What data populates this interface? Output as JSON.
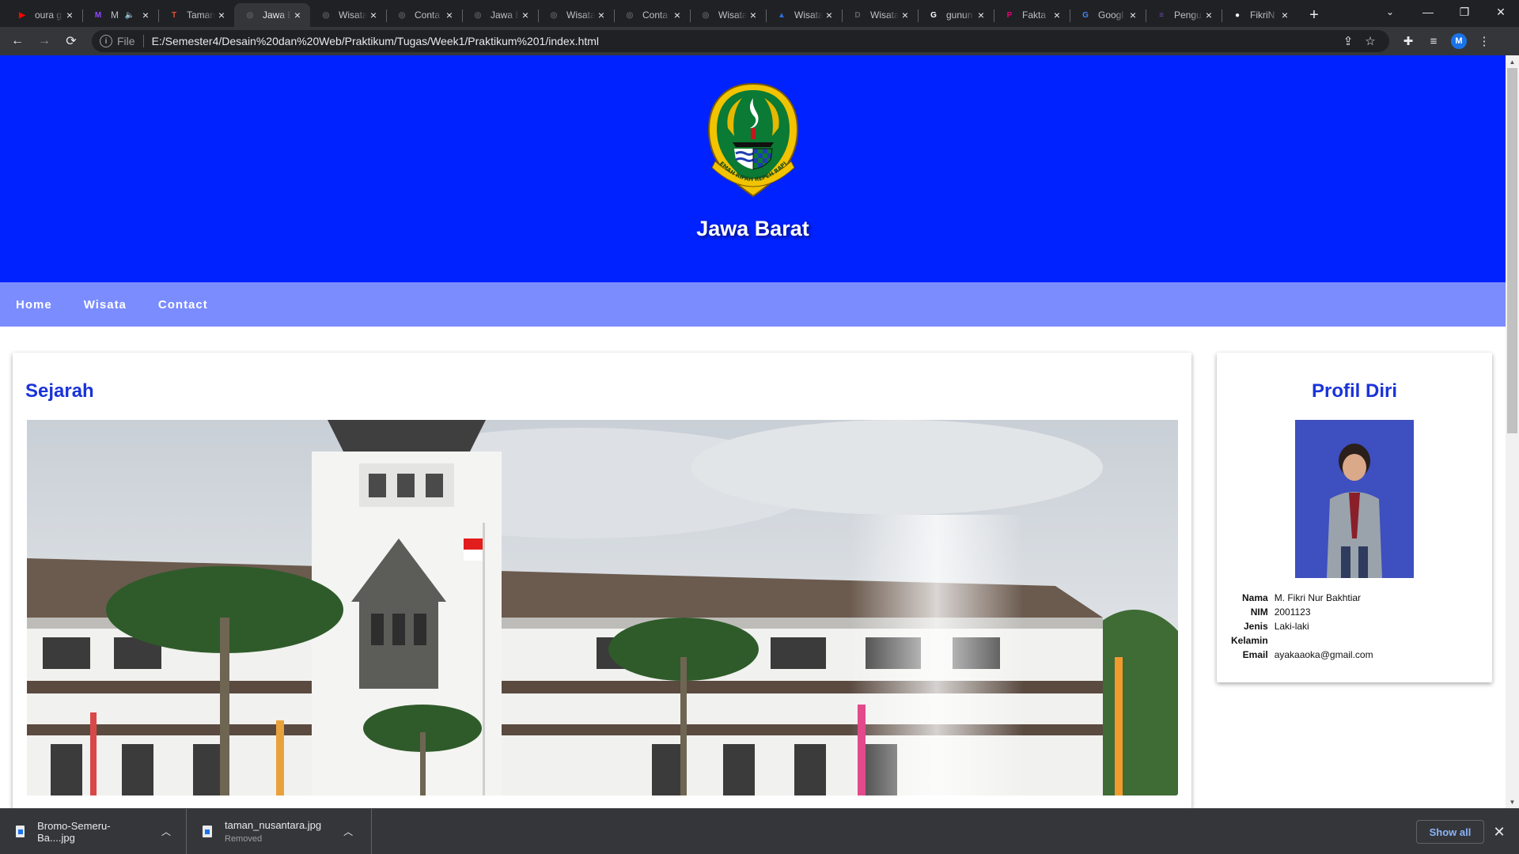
{
  "browser": {
    "tabs": [
      {
        "title": "oura g",
        "favicon": "youtube-icon",
        "color": "#ff0000",
        "glyph": "▶"
      },
      {
        "title": "M",
        "favicon": "twitch-icon",
        "color": "#9146ff",
        "glyph": "M",
        "muted": true
      },
      {
        "title": "Taman",
        "favicon": "app-icon",
        "color": "#e8522f",
        "glyph": "T"
      },
      {
        "title": "Jawa B",
        "favicon": "globe-icon",
        "color": "#5f6368",
        "glyph": "◎",
        "active": true
      },
      {
        "title": "Wisata",
        "favicon": "globe-icon",
        "color": "#5f6368",
        "glyph": "◎"
      },
      {
        "title": "Conta",
        "favicon": "globe-icon",
        "color": "#5f6368",
        "glyph": "◎"
      },
      {
        "title": "Jawa B",
        "favicon": "globe-icon",
        "color": "#5f6368",
        "glyph": "◎"
      },
      {
        "title": "Wisata",
        "favicon": "globe-icon",
        "color": "#5f6368",
        "glyph": "◎"
      },
      {
        "title": "Conta",
        "favicon": "globe-icon",
        "color": "#5f6368",
        "glyph": "◎"
      },
      {
        "title": "Wisata",
        "favicon": "globe-icon",
        "color": "#5f6368",
        "glyph": "◎"
      },
      {
        "title": "Wisata",
        "favicon": "bird-icon",
        "color": "#2f6fd8",
        "glyph": "▲"
      },
      {
        "title": "Wisata",
        "favicon": "dicoding-icon",
        "color": "#5f6368",
        "glyph": "D"
      },
      {
        "title": "gunun",
        "favicon": "google-icon",
        "color": "#ffffff",
        "glyph": "G"
      },
      {
        "title": "Fakta",
        "favicon": "pinterest-icon",
        "color": "#e60073",
        "glyph": "P"
      },
      {
        "title": "Googl",
        "favicon": "translate-icon",
        "color": "#4285f4",
        "glyph": "G"
      },
      {
        "title": "Pengu",
        "favicon": "forms-icon",
        "color": "#7248b9",
        "glyph": "≡"
      },
      {
        "title": "FikriN",
        "favicon": "github-icon",
        "color": "#ffffff",
        "glyph": "●"
      }
    ],
    "address": {
      "scheme": "File",
      "url": "E:/Semester4/Desain%20dan%20Web/Praktikum/Tugas/Week1/Praktikum%201/index.html"
    },
    "profile_initial": "M"
  },
  "site": {
    "title": "Jawa Barat",
    "logo_name": "jawa-barat-emblem",
    "logo_motto": "GEMAH RIPAH REPEH RAPIH",
    "header_color": "#0022ff",
    "nav_color": "#7b8cff",
    "heading_color": "#1a33d9",
    "nav": [
      "Home",
      "Wisata",
      "Contact"
    ]
  },
  "main": {
    "heading": "Sejarah",
    "image_alt": "Gedung Sate"
  },
  "profile": {
    "heading": "Profil Diri",
    "rows": [
      {
        "label": "Nama",
        "value": "M. Fikri Nur Bakhtiar"
      },
      {
        "label": "NIM",
        "value": "2001123"
      },
      {
        "label": "Jenis",
        "value": "Laki-laki"
      },
      {
        "label": "Kelamin",
        "value": ""
      },
      {
        "label": "Email",
        "value": "ayakaaoka@gmail.com"
      }
    ]
  },
  "downloads": {
    "items": [
      {
        "name": "Bromo-Semeru-Ba....jpg",
        "status": ""
      },
      {
        "name": "taman_nusantara.jpg",
        "status": "Removed"
      }
    ],
    "show_all": "Show all"
  }
}
